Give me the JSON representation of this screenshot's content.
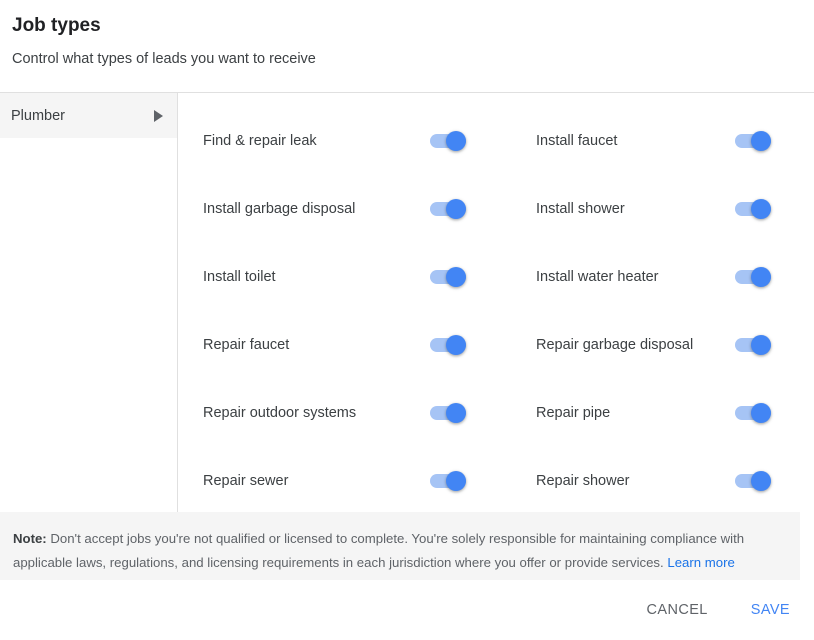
{
  "header": {
    "title": "Job types",
    "subtitle": "Control what types of leads you want to receive"
  },
  "sidebar": {
    "items": [
      {
        "label": "Plumber",
        "selected": true,
        "icon": "chevron-right-icon"
      }
    ]
  },
  "job_types": {
    "left_column": [
      {
        "label": "Find & repair leak",
        "enabled": true
      },
      {
        "label": "Install garbage disposal",
        "enabled": true
      },
      {
        "label": "Install toilet",
        "enabled": true
      },
      {
        "label": "Repair faucet",
        "enabled": true
      },
      {
        "label": "Repair outdoor systems",
        "enabled": true
      },
      {
        "label": "Repair sewer",
        "enabled": true
      }
    ],
    "right_column": [
      {
        "label": "Install faucet",
        "enabled": true
      },
      {
        "label": "Install shower",
        "enabled": true
      },
      {
        "label": "Install water heater",
        "enabled": true
      },
      {
        "label": "Repair garbage disposal",
        "enabled": true
      },
      {
        "label": "Repair pipe",
        "enabled": true
      },
      {
        "label": "Repair shower",
        "enabled": true
      }
    ]
  },
  "note": {
    "label": "Note:",
    "body": " Don't accept jobs you're not qualified or licensed to complete. You're solely responsible for maintaining compliance with applicable laws, regulations, and licensing requirements in each jurisdiction where you offer or provide services. ",
    "link": "Learn more"
  },
  "footer": {
    "cancel_label": "CANCEL",
    "save_label": "SAVE"
  },
  "colors": {
    "accent": "#4285f4",
    "link": "#1a73e8",
    "track_on": "#a6c4f5",
    "text_primary": "#202124",
    "text_secondary": "#5f6368",
    "band_background": "#f5f5f5",
    "divider": "#e0e0e0"
  }
}
